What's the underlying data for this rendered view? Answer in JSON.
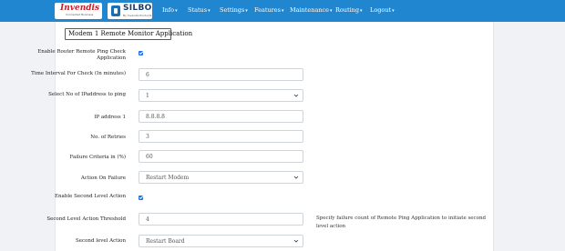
{
  "nav": {
    "logo_invendis": "Invendis",
    "logo_invendis_tagline": "Connected  Business",
    "logo_silbo": "SILBO",
    "logo_silbo_tagline": "By Invendis Products",
    "menu": [
      {
        "label": "Info"
      },
      {
        "label": "Status"
      },
      {
        "label": "Settings"
      },
      {
        "label": "Features"
      },
      {
        "label": "Maintenance"
      },
      {
        "label": "Routing"
      },
      {
        "label": "Logout"
      }
    ]
  },
  "page": {
    "title": "Modem 1 Remote Monitor Application"
  },
  "form": {
    "enable_ping_label": "Enable Router Remote Ping Check Application",
    "enable_ping_checked": true,
    "interval_label": "Time Interval For Check (In minutes)",
    "interval_value": "6",
    "ip_count_label": "Select No of IPaddress to ping",
    "ip_count_value": "1",
    "ip1_label": "IP address 1",
    "ip1_value": "8.8.8.8",
    "retries_label": "No. of Retries",
    "retries_value": "3",
    "failure_label": "Failure Criteria in (%)",
    "failure_value": "60",
    "action_label": "Action On Failure",
    "action_value": "Restart Modem",
    "enable_second_label": "Enable Second Level Action",
    "enable_second_checked": true,
    "threshold_label": "Second Level Action Threshold",
    "threshold_value": "4",
    "threshold_hint": "Specify failure count of Remote Ping Application to initiate second level action",
    "second_action_label": "Second level Action",
    "second_action_value": "Restart Board"
  },
  "colors": {
    "navbar": "#1f86cf",
    "checkbox": "#1a73e8",
    "title_border": "#d9232d"
  }
}
